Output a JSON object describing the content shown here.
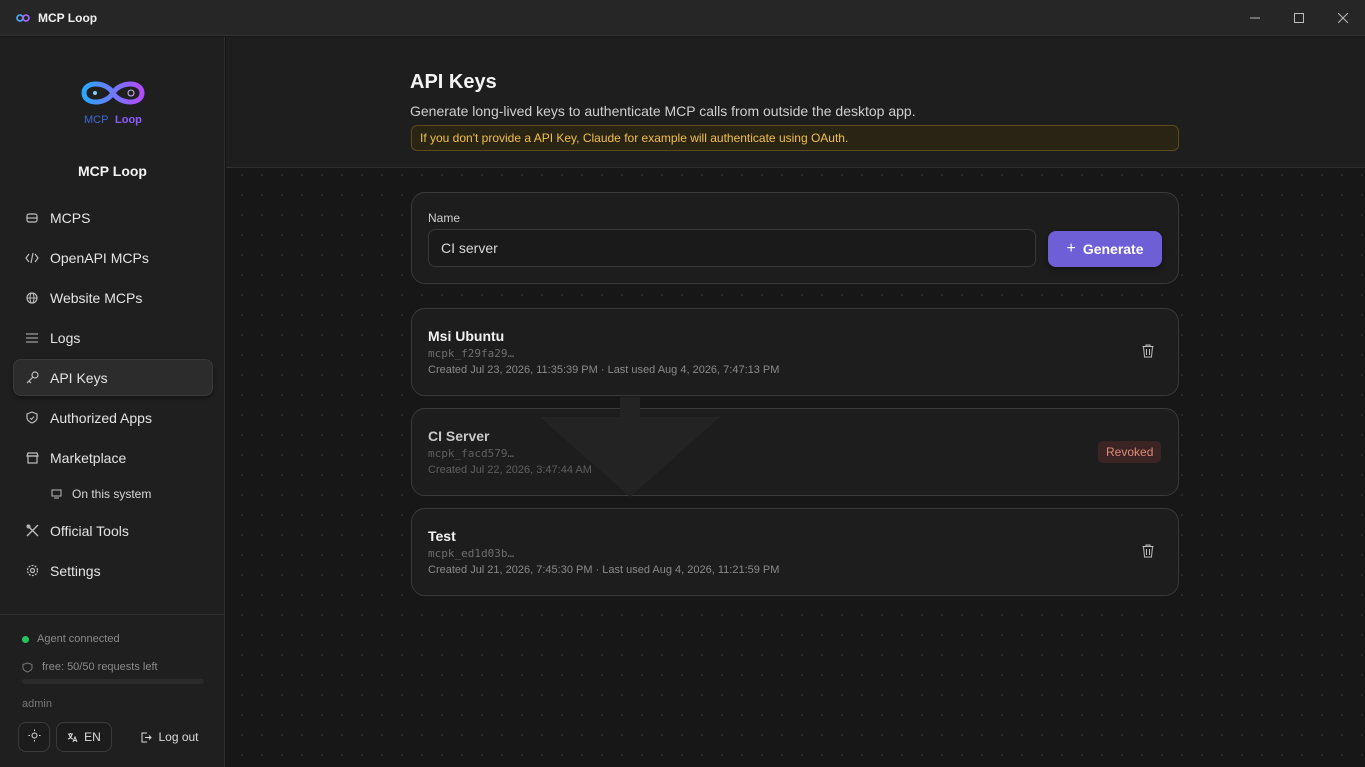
{
  "window": {
    "title": "MCP Loop"
  },
  "sidebar": {
    "brand": "MCP Loop",
    "logo_text_left": "MCP",
    "logo_text_right": "Loop",
    "items": [
      {
        "label": "MCPS",
        "icon": "database-icon"
      },
      {
        "label": "OpenAPI MCPs",
        "icon": "code-icon"
      },
      {
        "label": "Website MCPs",
        "icon": "globe-icon"
      },
      {
        "label": "Logs",
        "icon": "list-icon"
      },
      {
        "label": "API Keys",
        "icon": "key-icon"
      },
      {
        "label": "Authorized Apps",
        "icon": "shield-icon"
      },
      {
        "label": "Marketplace",
        "icon": "store-icon"
      },
      {
        "label": "On this system",
        "icon": "monitor-icon"
      },
      {
        "label": "Official Tools",
        "icon": "tools-icon"
      },
      {
        "label": "Settings",
        "icon": "gear-icon"
      }
    ],
    "active": "API Keys",
    "agent_status": "Agent connected",
    "quota": "free: 50/50 requests left",
    "quota_used_fraction": 0,
    "user": "admin",
    "lang": "EN",
    "logout": "Log out"
  },
  "header": {
    "title": "API Keys",
    "subtitle": "Generate long-lived keys to authenticate MCP calls from outside the desktop app.",
    "notice": "If you don't provide a API Key, Claude for example will authenticate using OAuth."
  },
  "form": {
    "label": "Name",
    "value": "CI server",
    "generate": "Generate"
  },
  "keys": [
    {
      "name": "Msi Ubuntu",
      "id": "mcpk_f29fa29…",
      "meta": "Created Jul 23, 2026, 11:35:39 PM · Last used Aug 4, 2026, 7:47:13 PM",
      "status": "active"
    },
    {
      "name": "CI Server",
      "id": "mcpk_facd579…",
      "meta": "Created Jul 22, 2026, 3:47:44 AM",
      "status": "Revoked"
    },
    {
      "name": "Test",
      "id": "mcpk_ed1d03b…",
      "meta": "Created Jul 21, 2026, 7:45:30 PM · Last used Aug 4, 2026, 11:21:59 PM",
      "status": "active"
    }
  ],
  "colors": {
    "accent": "#6f5fd6",
    "notice_text": "#f0c04a",
    "status_dot": "#22c55e",
    "revoked_text": "#e08a7a"
  }
}
